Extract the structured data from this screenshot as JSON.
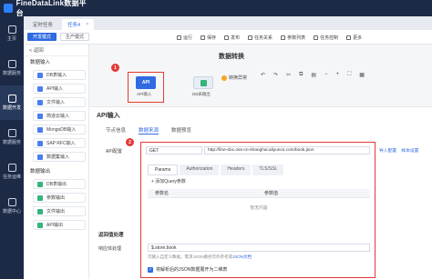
{
  "app": {
    "title": "FineDataLink数据平台"
  },
  "nav": [
    {
      "label": "主页"
    },
    {
      "label": "数据服务"
    },
    {
      "label": "数据开发"
    },
    {
      "label": "数据服务"
    },
    {
      "label": "任务运维"
    },
    {
      "label": "数据中心"
    }
  ],
  "tabs": [
    {
      "label": "定时任务"
    },
    {
      "label": "任务4"
    }
  ],
  "toolbar": {
    "mode_dev": "开发模式",
    "mode_prod": "生产模式",
    "buttons": [
      "运行",
      "保存",
      "发布",
      "任务关系",
      "参数列表",
      "任务控制",
      "更多"
    ]
  },
  "steps": {
    "back": "< 返回",
    "group_input": "数据输入",
    "input_items": [
      "DB表输入",
      "API输入",
      "文件输入",
      "简道云输入",
      "MongoDB输入",
      "SAP RFC输入",
      "数据集输入"
    ],
    "group_output": "数据输出",
    "output_items": [
      "DB表输出",
      "参数输出",
      "文件输出",
      "API输出"
    ]
  },
  "canvas": {
    "title": "数据转换",
    "node1_icon": "API",
    "node1_label": "API输入",
    "node2_label": "DB表输出",
    "warning": "转换异常",
    "badge1": "1",
    "badge2": "2"
  },
  "panel": {
    "title": "API输入",
    "subtabs": [
      "节点信息",
      "数据来源",
      "数据预览"
    ],
    "api_label": "API配置",
    "method": "GET",
    "url": "http://fine-doc.oss-cn-shanghai.aliyuncs.com/book.json",
    "link_import": "导入配置",
    "link_sample": "样本设置",
    "param_tabs": [
      "Params",
      "Authorization",
      "Headers",
      "TLS/SSL"
    ],
    "add_query": "+ 添加Query参数",
    "col_name": "参数名",
    "col_value": "参数值",
    "empty": "暂无内容",
    "section_resp": "返回值处理",
    "resp_label": "响应体处理",
    "resp_value": "$.store.book",
    "hint": "可输入自定义数据，需求JSON路径可作参考或",
    "hint_link": "JSON文档",
    "checkbox_label": "将解析后的JSON数据展开为二维表"
  },
  "colors": {
    "accent": "#2f6be3",
    "nav_bg": "#1c2a45",
    "highlight": "#e53935"
  }
}
